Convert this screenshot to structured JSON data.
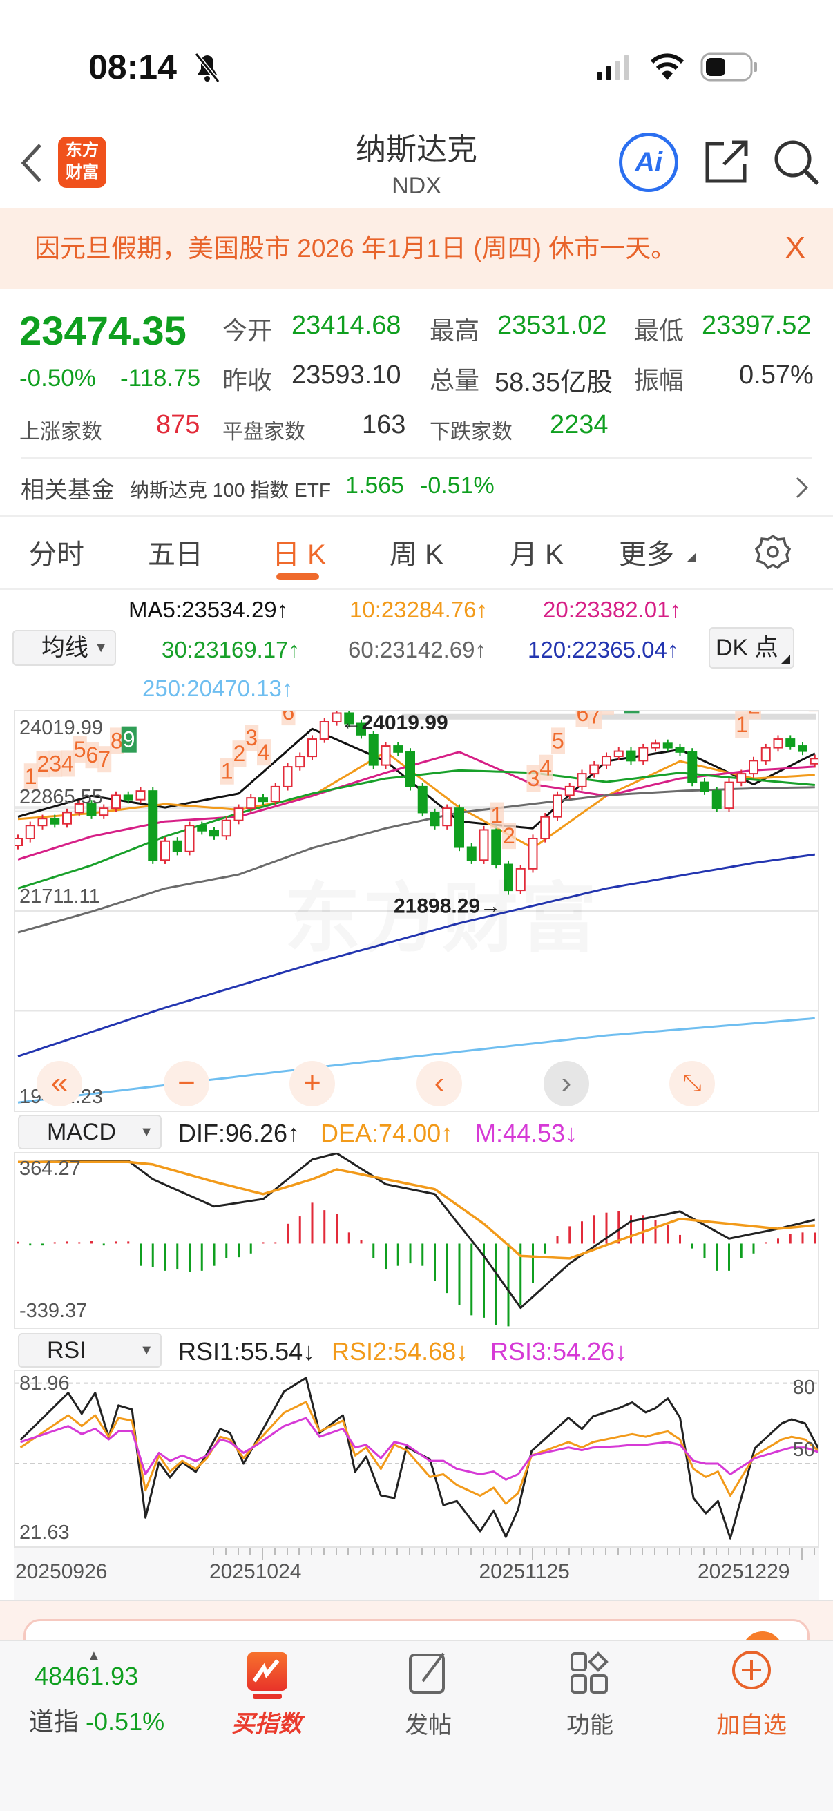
{
  "status_bar": {
    "time": "08:14"
  },
  "nav": {
    "title": "纳斯达克",
    "code": "NDX",
    "logo_text": "东方财富",
    "ai_label": "Ai"
  },
  "banner": {
    "text": "因元旦假期，美国股市 2026 年1月1日 (周四) 休市一天。",
    "close": "X"
  },
  "quote": {
    "price": "23474.35",
    "change_pct": "-0.50%",
    "change": "-118.75",
    "open_label": "今开",
    "open": "23414.68",
    "high_label": "最高",
    "high": "23531.02",
    "low_label": "最低",
    "low": "23397.52",
    "prev_label": "昨收",
    "prev": "23593.10",
    "vol_label": "总量",
    "vol": "58.35亿股",
    "amp_label": "振幅",
    "amp": "0.57%",
    "up_label": "上涨家数",
    "up": "875",
    "flat_label": "平盘家数",
    "flat": "163",
    "down_label": "下跌家数",
    "down": "2234"
  },
  "fund": {
    "label": "相关基金",
    "name": "纳斯达克 100 指数 ETF",
    "price": "1.565",
    "pct": "-0.51%"
  },
  "tabs": [
    "分时",
    "五日",
    "日 K",
    "周 K",
    "月 K",
    "更多"
  ],
  "active_tab": 2,
  "ma_legend": {
    "selector": "均线",
    "dk": "DK 点",
    "ma5": "MA5:23534.29↑",
    "ma10": "10:23284.76↑",
    "ma20": "20:23382.01↑",
    "ma30": "30:23169.17↑",
    "ma60": "60:23142.69↑",
    "ma120": "120:22365.04↑",
    "ma250": "250:20470.13↑"
  },
  "colors": {
    "up": "#e22b3a",
    "down": "#0f9f1f",
    "ma5": "#111111",
    "ma10": "#f29a1a",
    "ma20": "#d61f86",
    "ma30": "#18a02a",
    "ma60": "#6b6b6b",
    "ma120": "#2335b0",
    "ma250": "#6fbef0",
    "accent": "#ef6a2c"
  },
  "chart_data": [
    {
      "type": "candlestick",
      "title": "纳斯达克 NDX 日K",
      "ylim": [
        19402.23,
        24019.99
      ],
      "y_ticks": [
        "24019.99",
        "22865.55",
        "21711.11",
        "19402.23"
      ],
      "closes": [
        22550,
        22700,
        22780,
        22720,
        22850,
        22950,
        22820,
        22900,
        23050,
        23000,
        23100,
        22300,
        22520,
        22400,
        22700,
        22640,
        22580,
        22760,
        22900,
        23020,
        22980,
        23150,
        23380,
        23500,
        23700,
        23900,
        24000,
        23880,
        23750,
        23400,
        23620,
        23550,
        23150,
        22850,
        22700,
        22900,
        22450,
        22300,
        22650,
        22250,
        21950,
        22200,
        22550,
        22800,
        23050,
        23150,
        23300,
        23400,
        23500,
        23560,
        23450,
        23600,
        23650,
        23600,
        23550,
        23200,
        23100,
        22900,
        23200,
        23300,
        23450,
        23600,
        23700,
        23620,
        23560,
        23474.35
      ],
      "last_open": 23414.68,
      "max_mark": {
        "index": 26,
        "value": 24019.99,
        "label": "24019.99"
      },
      "min_mark": {
        "index": 40,
        "value": 21898.29,
        "label": "21898.29"
      },
      "ma_series": [
        {
          "name": "ma5",
          "idx": [
            0,
            6,
            12,
            18,
            24,
            30,
            36,
            42,
            48,
            54,
            60,
            65
          ],
          "values": [
            22802,
            23043,
            22909,
            23070,
            23819,
            23444,
            22748,
            22668,
            23444,
            23578,
            23177,
            23534.29
          ]
        },
        {
          "name": "ma10",
          "idx": [
            0,
            6,
            12,
            18,
            24,
            30,
            36,
            42,
            48,
            54,
            60,
            65
          ],
          "values": [
            22775,
            22842,
            22949,
            22882,
            23043,
            23551,
            22909,
            22440,
            23043,
            23444,
            23244,
            23284.76
          ]
        },
        {
          "name": "ma20",
          "idx": [
            0,
            6,
            12,
            18,
            24,
            30,
            36,
            42,
            48,
            54,
            60,
            65
          ],
          "values": [
            22307,
            22574,
            22748,
            22802,
            23043,
            23311,
            23551,
            23177,
            23043,
            23244,
            23338,
            23382.01
          ]
        },
        {
          "name": "ma30",
          "idx": [
            0,
            6,
            12,
            18,
            24,
            30,
            36,
            42,
            48,
            54,
            60,
            65
          ],
          "values": [
            21972,
            22240,
            22574,
            22842,
            23070,
            23244,
            23338,
            23311,
            23204,
            23311,
            23230,
            23169.17
          ]
        },
        {
          "name": "ma60",
          "idx": [
            0,
            6,
            12,
            18,
            24,
            30,
            36,
            42,
            48,
            54,
            60,
            65
          ],
          "values": [
            21463,
            21704,
            21972,
            22133,
            22440,
            22668,
            22850,
            22950,
            23050,
            23100,
            23130,
            23142.69
          ]
        },
        {
          "name": "ma120",
          "idx": [
            0,
            12,
            24,
            36,
            48,
            60,
            65
          ],
          "values": [
            20031,
            20593,
            21101,
            21570,
            21972,
            22267,
            22365.04
          ]
        },
        {
          "name": "ma250",
          "idx": [
            0,
            24,
            48,
            65
          ],
          "values": [
            19496,
            19897,
            20272,
            20470.13
          ]
        }
      ],
      "td_labels": [
        [
          1,
          "1"
        ],
        [
          2,
          "2"
        ],
        [
          3,
          "3"
        ],
        [
          4,
          "4"
        ],
        [
          5,
          "5"
        ],
        [
          6,
          "6"
        ],
        [
          7,
          "7"
        ],
        [
          8,
          "8"
        ],
        [
          9,
          "9g"
        ],
        [
          17,
          "1"
        ],
        [
          18,
          "2"
        ],
        [
          19,
          "3"
        ],
        [
          20,
          "4"
        ],
        [
          22,
          "6"
        ],
        [
          23,
          "5"
        ],
        [
          24,
          "7"
        ],
        [
          25,
          "8"
        ],
        [
          27,
          "9g"
        ],
        [
          39,
          "1"
        ],
        [
          40,
          "2"
        ],
        [
          42,
          "3"
        ],
        [
          43,
          "4"
        ],
        [
          44,
          "5"
        ],
        [
          46,
          "6"
        ],
        [
          47,
          "7"
        ],
        [
          48,
          "8"
        ],
        [
          50,
          "9g"
        ],
        [
          59,
          "1"
        ],
        [
          60,
          "2"
        ],
        [
          62,
          "3"
        ],
        [
          63,
          "4"
        ],
        [
          64,
          "5"
        ],
        [
          65,
          "6"
        ]
      ]
    },
    {
      "type": "bar+line",
      "title": "MACD",
      "ylim": [
        -339.37,
        364.27
      ],
      "y_ticks": [
        "364.27",
        "-339.37"
      ],
      "legend": {
        "selector": "MACD",
        "dif": "DIF:96.26↑",
        "dea": "DEA:74.00↑",
        "m": "M:44.53↓"
      },
      "m": [
        2,
        -2,
        -2,
        0,
        3,
        0,
        4,
        -2,
        3,
        3,
        -90,
        -95,
        -110,
        -105,
        -115,
        -110,
        -90,
        -60,
        -55,
        -40,
        0,
        0,
        80,
        110,
        165,
        135,
        120,
        45,
        15,
        -60,
        -105,
        -90,
        -80,
        -90,
        -150,
        -200,
        -250,
        -290,
        -300,
        -330,
        -335,
        -250,
        -160,
        -40,
        30,
        70,
        90,
        115,
        125,
        130,
        115,
        115,
        95,
        75,
        35,
        -20,
        -60,
        -110,
        -110,
        -60,
        -40,
        0,
        20,
        40,
        45,
        44.53
      ],
      "dif": {
        "idx": [
          0,
          9,
          11,
          16,
          20,
          24,
          26,
          30,
          34,
          38,
          41,
          45,
          50,
          54,
          58,
          62,
          65
        ],
        "values": [
          330,
          335,
          260,
          150,
          180,
          340,
          365,
          240,
          200,
          -50,
          -260,
          -80,
          90,
          130,
          20,
          60,
          96.26
        ]
      },
      "dea": {
        "idx": [
          0,
          9,
          11,
          16,
          20,
          24,
          26,
          30,
          34,
          38,
          41,
          45,
          50,
          54,
          58,
          62,
          65
        ],
        "values": [
          330,
          330,
          320,
          250,
          200,
          260,
          300,
          260,
          220,
          80,
          -50,
          -60,
          30,
          100,
          80,
          60,
          74.0
        ]
      }
    },
    {
      "type": "line",
      "title": "RSI",
      "ylim": [
        21.63,
        81.96
      ],
      "y_ticks": [
        "81.96",
        "21.63"
      ],
      "right_ticks": [
        "80",
        "50"
      ],
      "legend": {
        "selector": "RSI",
        "rsi1": "RSI1:55.54↓",
        "rsi2": "RSI2:54.68↓",
        "rsi3": "RSI3:54.26↓"
      },
      "idx": [
        0.2,
        4.1,
        5.2,
        6.3,
        7.4,
        8.2,
        9.3,
        10.4,
        11.5,
        12.4,
        13.4,
        14.5,
        15.4,
        16.5,
        17.3,
        18.4,
        19.5,
        21.7,
        23.5,
        24.6,
        26.5,
        27.5,
        28.4,
        29.6,
        30.7,
        31.7,
        33.6,
        34.7,
        35.8,
        37.7,
        38.8,
        39.8,
        40.8,
        41.9,
        44.9,
        46.0,
        46.9,
        49.0,
        50.1,
        51.2,
        52.0,
        53.0,
        54.0,
        55.1,
        56.1,
        57.1,
        58.1,
        60.1,
        62.3,
        63.1,
        64.2,
        65.3
      ],
      "rsi1": [
        58.8,
        76.4,
        68.6,
        76.4,
        59.8,
        71.7,
        70.2,
        29.8,
        50.5,
        44.8,
        50.5,
        46.9,
        53.6,
        62.9,
        61.4,
        50,
        58.8,
        76.9,
        82,
        61.4,
        68,
        46.9,
        52.6,
        38.1,
        37.1,
        56.2,
        51.6,
        34.5,
        36,
        24.7,
        32.4,
        22.6,
        32.9,
        54.7,
        67.1,
        62.9,
        67.6,
        70.7,
        72.8,
        69.1,
        70.7,
        74.3,
        67.1,
        37.1,
        31.4,
        36,
        22.1,
        55.7,
        65,
        66.5,
        65,
        55.54
      ],
      "rsi2": [
        56,
        68,
        64,
        68,
        60,
        67,
        66,
        40,
        53,
        47,
        51,
        48,
        52,
        60,
        59,
        52,
        58,
        69,
        73,
        62,
        66,
        53,
        56,
        48,
        57,
        55,
        45,
        46,
        42,
        38,
        41,
        35,
        39,
        53,
        58,
        56,
        58,
        60,
        61,
        60,
        61,
        62,
        59,
        48,
        45,
        47,
        38,
        53,
        59,
        60,
        59,
        54.68
      ],
      "rsi3": [
        58,
        64,
        61,
        63,
        59,
        62,
        62,
        46,
        54,
        51,
        53,
        51,
        53,
        59,
        58,
        54,
        57,
        64,
        67,
        60,
        63,
        56,
        57,
        52,
        58,
        57,
        51,
        51,
        48,
        46,
        47,
        44,
        46,
        53,
        56,
        55,
        56,
        56.5,
        57,
        57,
        57.5,
        58,
        57,
        51,
        50,
        50,
        46,
        52,
        55,
        56,
        56,
        54.26
      ]
    }
  ],
  "dates": [
    {
      "index": 0,
      "label": "20250926"
    },
    {
      "index": 20,
      "label": "20251024"
    },
    {
      "index": 42,
      "label": "20251125"
    },
    {
      "index": 64,
      "label": "20251229"
    }
  ],
  "bottom_bar": {
    "dow_value": "48461.93",
    "dow_label": "道指",
    "dow_pct": "-0.51%",
    "buy": "买指数",
    "post": "发帖",
    "func": "功能",
    "add": "加自选"
  }
}
